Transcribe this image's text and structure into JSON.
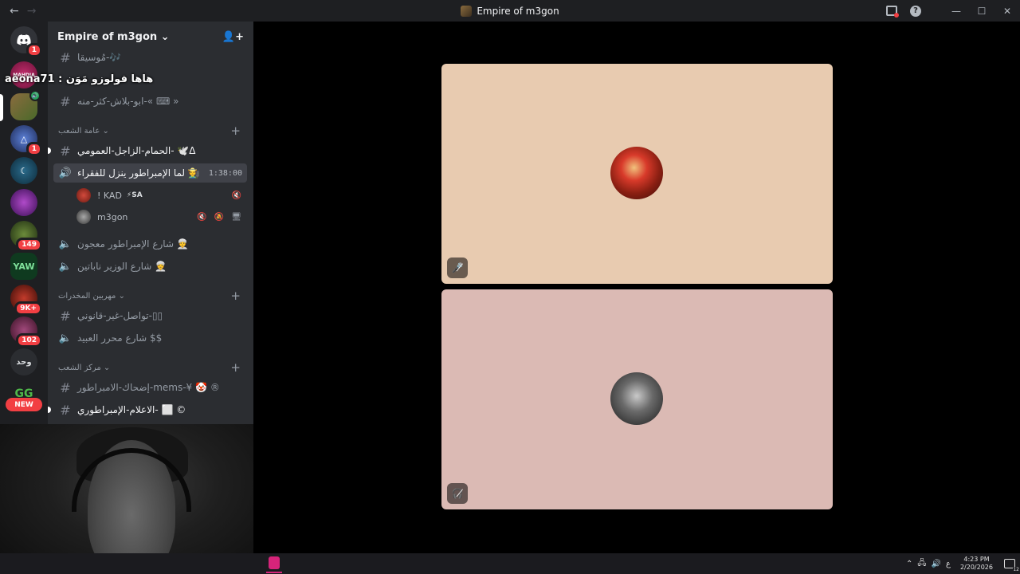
{
  "window": {
    "title": "Empire of m3gon",
    "back": "←",
    "forward": "→"
  },
  "guilds": [
    {
      "name": "discord-home",
      "badge": "1"
    },
    {
      "name": "guild-mahdia",
      "label": "MAHDIA"
    },
    {
      "name": "guild-empire",
      "active": true
    },
    {
      "name": "guild-triangle",
      "badge": "1"
    },
    {
      "name": "guild-moon"
    },
    {
      "name": "guild-purple"
    },
    {
      "name": "guild-green",
      "badge": "149"
    },
    {
      "name": "guild-yaw",
      "label": "YAW"
    },
    {
      "name": "guild-red",
      "badge": "9K+"
    },
    {
      "name": "guild-pixel",
      "badge": "102"
    },
    {
      "name": "guild-wahd",
      "label": "وحد"
    },
    {
      "name": "guild-gg",
      "label": "GG"
    }
  ],
  "new_pill": "NEW",
  "server": {
    "name": "Empire of m3gon"
  },
  "overlay_username": "aeona71 : هاها فولوزو مَوَن",
  "channels": {
    "music": "مُوسيقا-🎶",
    "abu_balash": "ابو-بلاش-كثر-منه-« ⌨ »",
    "cat1": "عامة الشعب",
    "pigeon": "الحمام-الزاجل-العمومي- 🕊️Δ",
    "voice_active": "لما الإمبراطور ينزل للفقراء 🧑‍🌾",
    "voice_timer": "1:38:00",
    "voice2": "شارع الإمبراطور معجون 👳",
    "voice3": "شارع الوزير ناباتين 👳",
    "cat2": "مهربين المخدرات",
    "illegal": "تواصل-غير-قانوني-▯▯",
    "slaves": "شارع محرر العبيد $$",
    "cat3": "مركز الشعب",
    "mems": "إضحاك-الامبراطور-mems-¥ 🤡 ®",
    "flags": "الاعلام-الإمبراطوري- ⬜ ©"
  },
  "voice_users": [
    {
      "name": "! KAD",
      "tag": "⚡SA",
      "icons": "🔇"
    },
    {
      "name": "m3gon",
      "icons": "🔇 🔕 🖥"
    }
  ],
  "tiles": [
    {
      "color": "#e8cbb0",
      "user": "KAD"
    },
    {
      "color": "#dbbab4",
      "user": "m3gon"
    }
  ],
  "taskbar": {
    "time": "4:23 PM",
    "date": "2/20/2026",
    "lang": "ع",
    "notif_count": "12"
  }
}
